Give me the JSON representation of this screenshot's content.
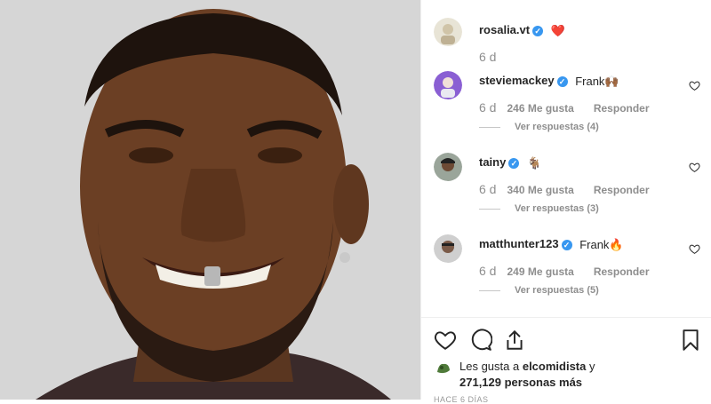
{
  "post": {
    "caption_comment": {
      "username": "rosalia.vt",
      "emoji": "❤️",
      "time": "6 d"
    },
    "comments": [
      {
        "username": "steviemackey",
        "text": "Frank🙌🏾",
        "time": "6 d",
        "likes": "246 Me gusta",
        "reply": "Responder",
        "view_replies": "Ver respuestas (4)"
      },
      {
        "username": "tainy",
        "text": "🐐",
        "time": "6 d",
        "likes": "340 Me gusta",
        "reply": "Responder",
        "view_replies": "Ver respuestas (3)"
      },
      {
        "username": "matthunter123",
        "text": "Frank🔥",
        "time": "6 d",
        "likes": "249 Me gusta",
        "reply": "Responder",
        "view_replies": "Ver respuestas (5)"
      }
    ],
    "likes": {
      "prefix": "Les gusta a",
      "user": "elcomidista",
      "suffix": "y",
      "count": "271,129 personas más"
    },
    "time_ago": "HACE 6 DÍAS"
  },
  "colors": {
    "verified": "#3897f0",
    "muted": "#8e8e8e",
    "text": "#262626"
  }
}
